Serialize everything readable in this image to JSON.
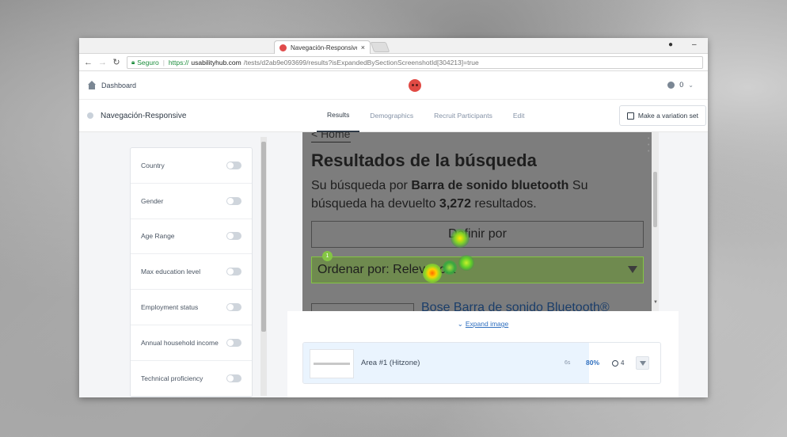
{
  "browser": {
    "tab_title": "Navegación-Responsive",
    "tab_close": "×",
    "secure_label": "Seguro",
    "url_proto": "https://",
    "url_host": "usabilityhub.com",
    "url_path": "/tests/d2ab9e093699/results?isExpandedBySectionScreenshotId[304213]=true",
    "window_minimize": "–",
    "profile_glyph": "●"
  },
  "header": {
    "dashboard_label": "Dashboard",
    "credits": "0",
    "chevron": "⌄"
  },
  "testbar": {
    "test_name": "Navegación-Responsive",
    "tabs": [
      "Results",
      "Demographics",
      "Recruit Participants",
      "Edit"
    ],
    "active_tab": "Results",
    "variation_label": "Make a variation set"
  },
  "filters": [
    {
      "label": "Country",
      "enabled": false
    },
    {
      "label": "Gender",
      "enabled": false
    },
    {
      "label": "Age Range",
      "enabled": false
    },
    {
      "label": "Max education level",
      "enabled": false
    },
    {
      "label": "Employment status",
      "enabled": false
    },
    {
      "label": "Annual household income",
      "enabled": false
    },
    {
      "label": "Technical proficiency",
      "enabled": false
    }
  ],
  "screenshot": {
    "back_link": "< Home",
    "heading": "Resultados de la búsqueda",
    "summary_prefix": "Su búsqueda por ",
    "summary_term": "Barra de sonido bluetooth",
    "summary_mid": " Su búsqueda ha devuelto ",
    "summary_count": "3,272",
    "summary_suffix": " resultados.",
    "define_label": "Definir por",
    "sort_label": "Ordenar por: Relevancia",
    "product_link": "Bose Barra de sonido Bluetooth®",
    "zone_number": "1"
  },
  "expand_label": "Expand image",
  "areas": [
    {
      "name": "Area #1 (Hitzone)",
      "time": "6s",
      "percent": "80%",
      "percent_value": 0.8,
      "participants": "4"
    }
  ],
  "colors": {
    "accent": "#2f6fbf",
    "hitzone": "#84c544",
    "brand": "#e14a44"
  }
}
